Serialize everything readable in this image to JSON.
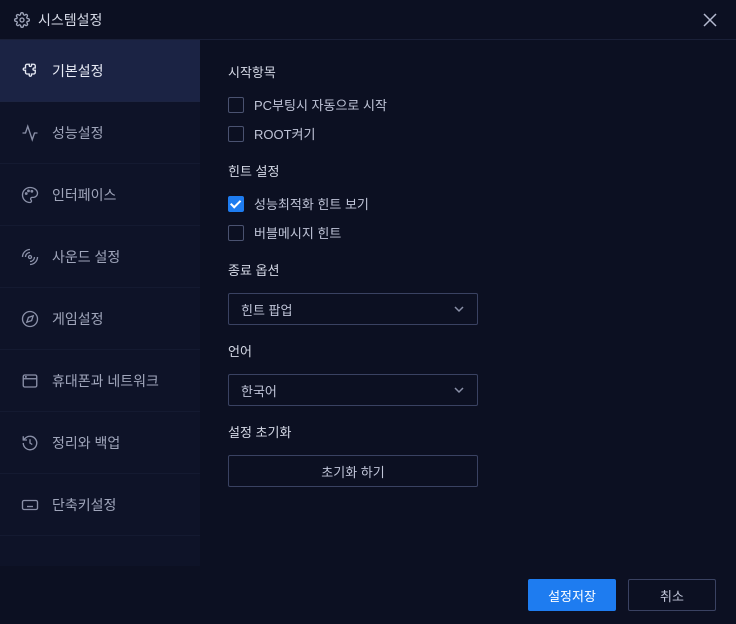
{
  "window": {
    "title": "시스템설정"
  },
  "sidebar": {
    "items": [
      {
        "label": "기본설정"
      },
      {
        "label": "성능설정"
      },
      {
        "label": "인터페이스"
      },
      {
        "label": "사운드 설정"
      },
      {
        "label": "게임설정"
      },
      {
        "label": "휴대폰과 네트워크"
      },
      {
        "label": "정리와 백업"
      },
      {
        "label": "단축키설정"
      }
    ]
  },
  "main": {
    "startup": {
      "heading": "시작항목",
      "autostart": {
        "label": "PC부팅시 자동으로 시작",
        "checked": false
      },
      "root": {
        "label": "ROOT켜기",
        "checked": false
      }
    },
    "hint": {
      "heading": "힌트 설정",
      "optimize": {
        "label": "성능최적화 힌트 보기",
        "checked": true
      },
      "bubble": {
        "label": "버블메시지 힌트",
        "checked": false
      }
    },
    "exit": {
      "heading": "종료 옵션",
      "selected": "힌트 팝업"
    },
    "language": {
      "heading": "언어",
      "selected": "한국어"
    },
    "reset": {
      "heading": "설정 초기화",
      "button": "초기화 하기"
    }
  },
  "footer": {
    "save": "설정저장",
    "cancel": "취소"
  }
}
